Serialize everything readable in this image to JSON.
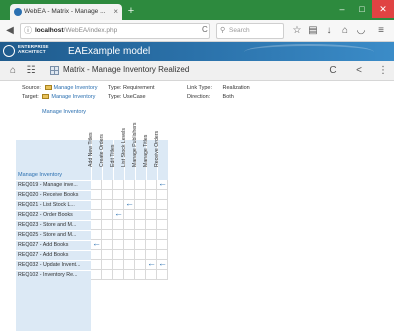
{
  "browser": {
    "tab_title": "WebEA - Matrix - Manage ...",
    "tab_close": "×",
    "new_tab": "+",
    "window_buttons": {
      "minimize": "–",
      "maximize": "□",
      "close": "✕"
    },
    "url_host": "localhost",
    "url_path": "/WebEA/index.php",
    "search_placeholder": "Search",
    "icons": {
      "back": "◀",
      "forward": "▶",
      "info": "ⓘ",
      "reload": "C",
      "star": "☆",
      "bookmarks": "▤",
      "download": "↓",
      "home": "⌂",
      "pocket": "◡",
      "menu": "≡",
      "magnifier": "⚲"
    }
  },
  "ea": {
    "logo_line1": "ENTERPRISE",
    "logo_line2": "ARCHITECT",
    "model_name": "EAExample model"
  },
  "toolbar": {
    "title": "Matrix - Manage Inventory Realized",
    "icons": {
      "home": "⌂",
      "tree": "☷",
      "refresh": "C",
      "share": "<",
      "more": "⋮"
    }
  },
  "meta": {
    "source_label": "Source:",
    "source_value": "Manage Inventory",
    "target_label": "Target:",
    "target_value": "Manage Inventory",
    "type_label_1": "Type:",
    "type_value_1": "Requirement",
    "type_label_2": "Type:",
    "type_value_2": "UseCase",
    "link_type_label": "Link Type:",
    "link_type_value": "Realization",
    "direction_label": "Direction:",
    "direction_value": "Both",
    "top_package": "Manage Inventory"
  },
  "matrix": {
    "corner_label": "Manage Inventory",
    "columns": [
      "Add New Titles",
      "Create Orders",
      "Edit Titles",
      "List Stock Levels",
      "Manage Publishers",
      "Manage Titles",
      "Receive Orders"
    ],
    "rows": [
      {
        "label": "REQ019 - Manage inve...",
        "cells": [
          0,
          0,
          0,
          0,
          0,
          0,
          1
        ]
      },
      {
        "label": "REQ020 - Receive Books",
        "cells": [
          0,
          0,
          0,
          0,
          0,
          0,
          0
        ]
      },
      {
        "label": "REQ021 - List Stock L...",
        "cells": [
          0,
          0,
          0,
          1,
          0,
          0,
          0
        ]
      },
      {
        "label": "REQ022 - Order Books",
        "cells": [
          0,
          0,
          1,
          0,
          0,
          0,
          0
        ]
      },
      {
        "label": "REQ023 - Store and M...",
        "cells": [
          0,
          0,
          0,
          0,
          0,
          0,
          0
        ]
      },
      {
        "label": "REQ025 - Store and M...",
        "cells": [
          0,
          0,
          0,
          0,
          0,
          0,
          0
        ]
      },
      {
        "label": "REQ027 - Add Books",
        "cells": [
          1,
          0,
          0,
          0,
          0,
          0,
          0
        ]
      },
      {
        "label": "REQ027 - Add Books",
        "cells": [
          0,
          0,
          0,
          0,
          0,
          0,
          0
        ]
      },
      {
        "label": "REQ032 - Update Invent...",
        "cells": [
          0,
          0,
          0,
          0,
          0,
          1,
          1
        ]
      },
      {
        "label": "REQ102 - Inventory Re...",
        "cells": [
          0,
          0,
          0,
          0,
          0,
          0,
          0
        ]
      }
    ],
    "arrow_color": "#2a6fb0"
  }
}
